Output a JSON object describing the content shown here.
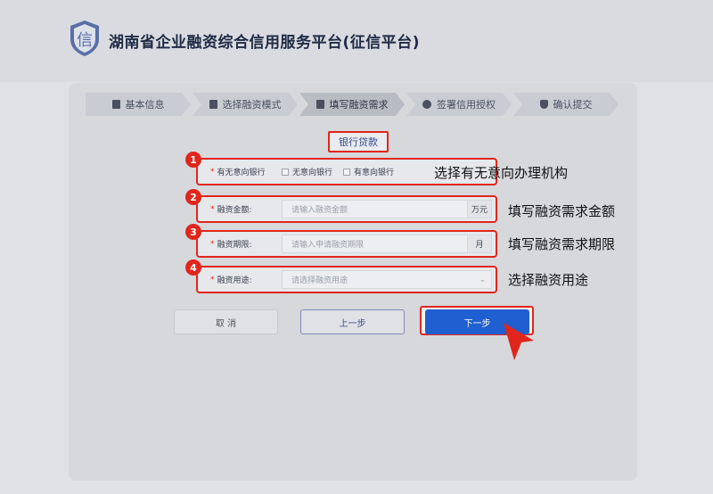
{
  "header": {
    "title": "湖南省企业融资综合信用服务平台(征信平台)",
    "logo_glyph": "信"
  },
  "steps": [
    {
      "label": "基本信息",
      "icon": "document-icon"
    },
    {
      "label": "选择融资模式",
      "icon": "document-icon"
    },
    {
      "label": "填写融资需求",
      "icon": "document-icon",
      "active": true
    },
    {
      "label": "签署信用授权",
      "icon": "seal-icon"
    },
    {
      "label": "确认提交",
      "icon": "shield-icon"
    }
  ],
  "loan_type": "银行贷款",
  "fields": {
    "bank_intent": {
      "label": "有无意向银行",
      "options": [
        "无意向银行",
        "有意向银行"
      ]
    },
    "amount": {
      "label": "融资金额:",
      "placeholder": "请输入融资金额",
      "unit": "万元"
    },
    "term": {
      "label": "融资期限:",
      "placeholder": "请输入申请融资期限",
      "unit": "月"
    },
    "purpose": {
      "label": "融资用途:",
      "placeholder": "请选择融资用途"
    }
  },
  "annotations": {
    "badges": [
      "1",
      "2",
      "3",
      "4"
    ],
    "notes": [
      "选择有无意向办理机构",
      "填写融资需求金额",
      "填写融资需求期限",
      "选择融资用途"
    ]
  },
  "buttons": {
    "cancel": "取 消",
    "prev": "上一步",
    "next": "下一步"
  },
  "colors": {
    "highlight": "#e0261c",
    "primary": "#1f5fcf"
  }
}
